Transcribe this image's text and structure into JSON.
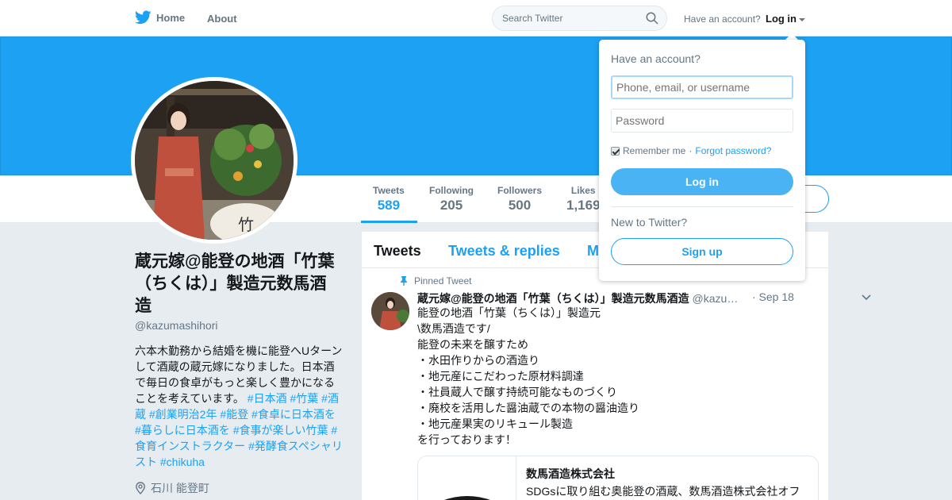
{
  "nav": {
    "home_label": "Home",
    "about_label": "About",
    "search_placeholder": "Search Twitter",
    "have_account_label": "Have an account?",
    "login_label": "Log in",
    "brand_color": "#1da1f2"
  },
  "profile": {
    "name": "蔵元嫁@能登の地酒「竹葉（ちくは）」製造元数馬酒造",
    "handle": "@kazumashihori",
    "bio_text": "六本木勤務から結婚を機に能登へUターンして酒蔵の蔵元嫁になりました。日本酒で毎日の食卓がもっと楽しく豊かになることを考えています。",
    "bio_tags": [
      "#日本酒",
      "#竹葉",
      "#酒蔵",
      "#創業明治2年",
      "#能登",
      "#食卓に日本酒を",
      "#暮らしに日本酒を",
      "#食事が楽しい竹葉",
      "#食育インストラクター",
      "#発酵食スペシャリスト",
      "#chikuha"
    ],
    "location": "石川 能登町"
  },
  "stats": [
    {
      "label": "Tweets",
      "value": "589"
    },
    {
      "label": "Following",
      "value": "205"
    },
    {
      "label": "Followers",
      "value": "500"
    },
    {
      "label": "Likes",
      "value": "1,169"
    }
  ],
  "timeline": {
    "tabs": [
      "Tweets",
      "Tweets & replies",
      "M"
    ],
    "pinned_label": "Pinned Tweet",
    "tweet": {
      "name": "蔵元嫁@能登の地酒「竹葉（ちくは）」製造元数馬酒造",
      "handle": "@kazu…",
      "date": "· Sep 18",
      "lines": [
        "能登の地酒「竹葉（ちくは）」製造元",
        "\\数馬酒造です/",
        "能登の未来を醸すため",
        "・水田作りからの酒造り",
        "・地元産にこだわった原材料調達",
        "・社員蔵人で醸す持続可能なものづくり",
        "・廃校を活用した醤油蔵での本物の醤油造り",
        "・地元産果実のリキュール製造",
        "を行っております！"
      ],
      "card_title": "数馬酒造株式会社",
      "card_desc": "SDGsに取り組む奥能登の酒蔵、数馬酒造株式会社オフ"
    }
  },
  "login_dropdown": {
    "heading": "Have an account?",
    "username_placeholder": "Phone, email, or username",
    "password_placeholder": "Password",
    "remember_label": "Remember me",
    "separator": " · ",
    "forgot_label": "Forgot password?",
    "login_button": "Log in",
    "new_label": "New to Twitter?",
    "signup_button": "Sign up"
  }
}
